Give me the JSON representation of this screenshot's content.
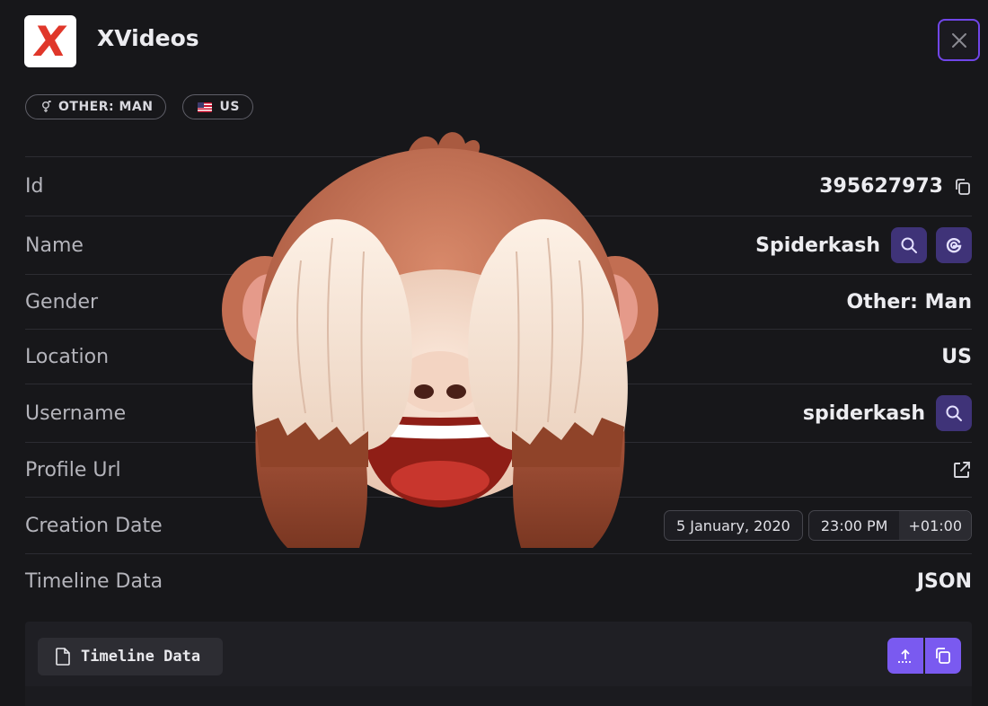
{
  "header": {
    "logo_letter": "X",
    "title": "XVideos"
  },
  "badges": [
    {
      "label": "OTHER: MAN",
      "icon": "gender-icon"
    },
    {
      "label": "US",
      "icon": "us-flag-icon"
    }
  ],
  "rows": {
    "id": {
      "label": "Id",
      "value": "395627973"
    },
    "name": {
      "label": "Name",
      "value": "Spiderkash"
    },
    "gender": {
      "label": "Gender",
      "value": "Other: Man"
    },
    "location": {
      "label": "Location",
      "value": "US"
    },
    "username": {
      "label": "Username",
      "value": "spiderkash"
    },
    "profile_url": {
      "label": "Profile Url"
    },
    "creation_date": {
      "label": "Creation Date",
      "date": "5 January, 2020",
      "time": "23:00 PM",
      "tz": "+01:00"
    },
    "timeline": {
      "label": "Timeline Data",
      "value": "JSON"
    }
  },
  "panel": {
    "tab_label": "Timeline Data"
  },
  "colors": {
    "background": "#17171a",
    "accent": "#7a5af0",
    "accent_dark": "#3f3378",
    "logo_red": "#e0372a"
  },
  "overlay": {
    "icon": "see-no-evil-monkey-emoji"
  }
}
